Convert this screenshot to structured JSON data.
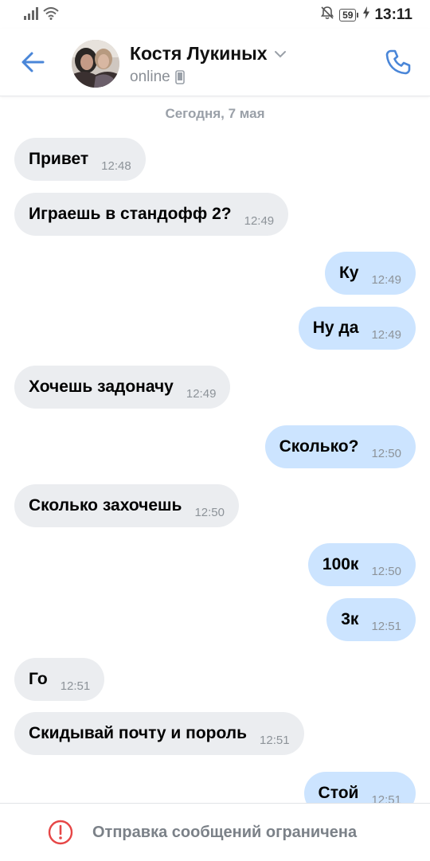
{
  "colors": {
    "accent": "#4a86d8",
    "incoming_bubble": "#ebedf0",
    "outgoing_bubble": "#cce4ff",
    "warning": "#e64646"
  },
  "status_bar": {
    "time": "13:11",
    "battery": "59",
    "icons": [
      "signal-icon",
      "wifi-icon",
      "mute-icon",
      "battery-icon",
      "charging-icon"
    ]
  },
  "header": {
    "name": "Костя Лукиных",
    "status": "online",
    "icons": [
      "back-arrow-icon",
      "chevron-down-icon",
      "mobile-device-icon",
      "phone-icon"
    ]
  },
  "chat": {
    "date": "Сегодня, 7 мая",
    "messages": [
      {
        "dir": "in",
        "text": "Привет",
        "time": "12:48"
      },
      {
        "dir": "in",
        "text": "Играешь в стандофф 2?",
        "time": "12:49"
      },
      {
        "dir": "out",
        "text": "Ку",
        "time": "12:49"
      },
      {
        "dir": "out",
        "text": "Ну да",
        "time": "12:49"
      },
      {
        "dir": "in",
        "text": "Хочешь задоначу",
        "time": "12:49"
      },
      {
        "dir": "out",
        "text": "Сколько?",
        "time": "12:50"
      },
      {
        "dir": "in",
        "text": "Сколько захочешь",
        "time": "12:50"
      },
      {
        "dir": "out",
        "text": "100к",
        "time": "12:50"
      },
      {
        "dir": "out",
        "text": "3к",
        "time": "12:51"
      },
      {
        "dir": "in",
        "text": "Го",
        "time": "12:51"
      },
      {
        "dir": "in",
        "text": "Скидывай почту и пороль",
        "time": "12:51"
      },
      {
        "dir": "out",
        "text": "Стой",
        "time": "12:51"
      }
    ]
  },
  "bottom": {
    "notice": "Отправка сообщений ограничена",
    "icon": "exclamation-circle-icon"
  }
}
